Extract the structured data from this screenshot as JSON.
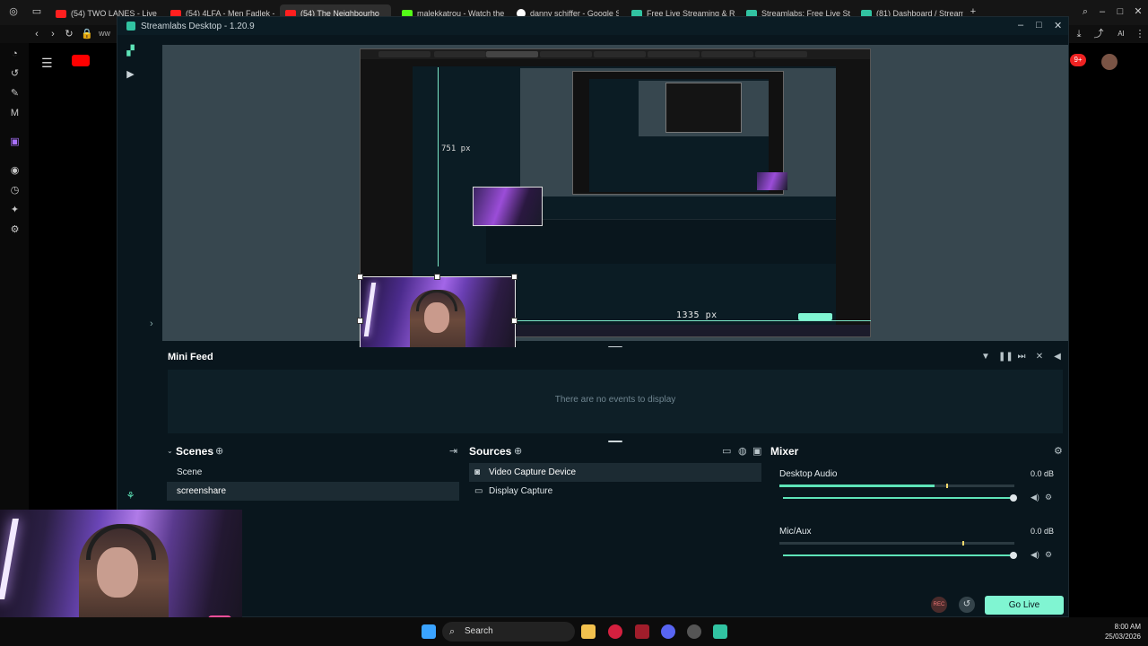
{
  "browser": {
    "tabs": [
      {
        "label": "(54) TWO LANES - Live fr",
        "icon": "yt"
      },
      {
        "label": "(54) 4LFA - Men Fadlek -",
        "icon": "yt"
      },
      {
        "label": "(54) The Neighbourho",
        "icon": "yt"
      },
      {
        "label": "malekkatrou - Watch the",
        "icon": "kick"
      },
      {
        "label": "danny schiffer - Google S",
        "icon": "google"
      },
      {
        "label": "Free Live Streaming & Re",
        "icon": "sl"
      },
      {
        "label": "Streamlabs: Free Live Stre",
        "icon": "sl"
      },
      {
        "label": "(81) Dashboard / Streamla",
        "icon": "sl"
      }
    ],
    "new_tab": "+",
    "url_hint": "ww",
    "notification_count": "9+"
  },
  "app": {
    "title": "Streamlabs Desktop - 1.20.9"
  },
  "preview": {
    "measure_vertical": "751 px",
    "measure_horizontal": "1335 px"
  },
  "minifeed": {
    "title": "Mini Feed",
    "empty_text": "There are no events to display"
  },
  "scenes": {
    "title": "Scenes",
    "items": [
      "Scene",
      "screenshare"
    ]
  },
  "sources": {
    "title": "Sources",
    "items": [
      "Video Capture Device",
      "Display Capture"
    ]
  },
  "mixer": {
    "title": "Mixer",
    "channels": [
      {
        "name": "Desktop Audio",
        "db": "0.0 dB",
        "meter_level": 0.66
      },
      {
        "name": "Mic/Aux",
        "db": "0.0 dB",
        "meter_level": 0.0
      }
    ]
  },
  "footer": {
    "rec_label": "REC",
    "golive_label": "Go Live"
  },
  "taskbar": {
    "search_placeholder": "Search",
    "time": "8:00 AM",
    "date": "25/03/2026"
  },
  "colors": {
    "accent": "#80f5d2",
    "panel_bg": "#09161d",
    "preview_bg": "#37474f"
  }
}
